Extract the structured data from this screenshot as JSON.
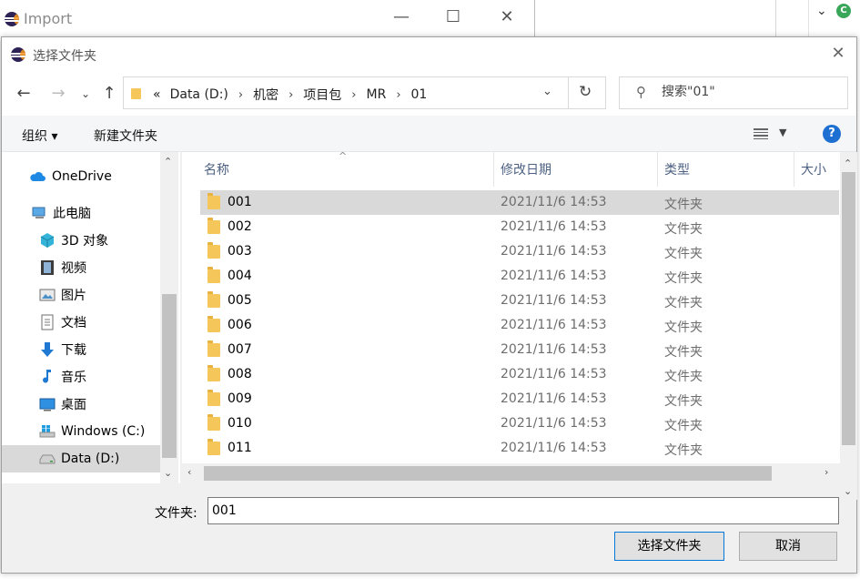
{
  "background_window": {
    "title": "Import",
    "minimize": "—",
    "maximize": "☐",
    "close": "✕"
  },
  "dialog": {
    "title": "选择文件夹",
    "close": "✕"
  },
  "address_bar": {
    "crumbs": [
      "«",
      "Data (D:)",
      "机密",
      "项目包",
      "MR",
      "01"
    ],
    "separator": "›"
  },
  "search": {
    "placeholder": "搜索\"01\""
  },
  "toolbar": {
    "organize": "组织 ▾",
    "new_folder": "新建文件夹",
    "help": "?"
  },
  "nav_items": [
    {
      "label": "OneDrive",
      "icon": "cloud-icon",
      "selected": false
    },
    {
      "label": "此电脑",
      "icon": "computer-icon",
      "selected": false
    },
    {
      "label": "3D 对象",
      "icon": "cube-icon",
      "selected": false
    },
    {
      "label": "视频",
      "icon": "video-icon",
      "selected": false
    },
    {
      "label": "图片",
      "icon": "picture-icon",
      "selected": false
    },
    {
      "label": "文档",
      "icon": "document-icon",
      "selected": false
    },
    {
      "label": "下载",
      "icon": "download-icon",
      "selected": false
    },
    {
      "label": "音乐",
      "icon": "music-icon",
      "selected": false
    },
    {
      "label": "桌面",
      "icon": "desktop-icon",
      "selected": false
    },
    {
      "label": "Windows (C:)",
      "icon": "windows-drive-icon",
      "selected": false
    },
    {
      "label": "Data (D:)",
      "icon": "drive-icon",
      "selected": true
    }
  ],
  "columns": {
    "name": "名称",
    "modified": "修改日期",
    "type": "类型",
    "size": "大小"
  },
  "files": [
    {
      "name": "001",
      "date": "2021/11/6 14:53",
      "type": "文件夹",
      "selected": true
    },
    {
      "name": "002",
      "date": "2021/11/6 14:53",
      "type": "文件夹",
      "selected": false
    },
    {
      "name": "003",
      "date": "2021/11/6 14:53",
      "type": "文件夹",
      "selected": false
    },
    {
      "name": "004",
      "date": "2021/11/6 14:53",
      "type": "文件夹",
      "selected": false
    },
    {
      "name": "005",
      "date": "2021/11/6 14:53",
      "type": "文件夹",
      "selected": false
    },
    {
      "name": "006",
      "date": "2021/11/6 14:53",
      "type": "文件夹",
      "selected": false
    },
    {
      "name": "007",
      "date": "2021/11/6 14:53",
      "type": "文件夹",
      "selected": false
    },
    {
      "name": "008",
      "date": "2021/11/6 14:53",
      "type": "文件夹",
      "selected": false
    },
    {
      "name": "009",
      "date": "2021/11/6 14:53",
      "type": "文件夹",
      "selected": false
    },
    {
      "name": "010",
      "date": "2021/11/6 14:53",
      "type": "文件夹",
      "selected": false
    },
    {
      "name": "011",
      "date": "2021/11/6 14:53",
      "type": "文件夹",
      "selected": false
    }
  ],
  "folder_field": {
    "label": "文件夹:",
    "value": "001"
  },
  "buttons": {
    "select": "选择文件夹",
    "cancel": "取消"
  },
  "colors": {
    "selection": "#d9d9d9",
    "folder": "#f5c65a",
    "header_text": "#4d6182",
    "help": "#1e6fd2"
  }
}
